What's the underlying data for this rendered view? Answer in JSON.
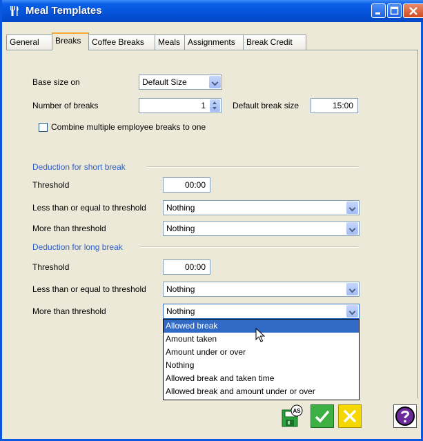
{
  "window": {
    "title": "Meal Templates",
    "title_icon": "fork-knife-icon"
  },
  "tabs": [
    {
      "label": "General",
      "active": false
    },
    {
      "label": "Breaks",
      "active": true
    },
    {
      "label": "Coffee Breaks",
      "active": false
    },
    {
      "label": "Meals",
      "active": false
    },
    {
      "label": "Assignments",
      "active": false
    },
    {
      "label": "Break Credit",
      "active": false
    }
  ],
  "form": {
    "base_size_label": "Base size on",
    "base_size_value": "Default Size",
    "num_breaks_label": "Number of breaks",
    "num_breaks_value": "1",
    "default_break_size_label": "Default break size",
    "default_break_size_value": "15:00",
    "combine_label": "Combine multiple employee breaks to one",
    "combine_checked": false
  },
  "short_break": {
    "heading": "Deduction for short break",
    "threshold_label": "Threshold",
    "threshold_value": "00:00",
    "le_label": "Less than or equal to threshold",
    "le_value": "Nothing",
    "gt_label": "More than threshold",
    "gt_value": "Nothing"
  },
  "long_break": {
    "heading": "Deduction for long break",
    "threshold_label": "Threshold",
    "threshold_value": "00:00",
    "le_label": "Less than or equal to threshold",
    "le_value": "Nothing",
    "gt_label": "More than threshold",
    "gt_value": "Nothing"
  },
  "dropdown_options": [
    "Allowed break",
    "Amount taken",
    "Amount under or over",
    "Nothing",
    "Allowed break and taken time",
    "Allowed break and amount under or over"
  ],
  "dropdown_highlighted": "Allowed break",
  "footer": {
    "save_as_badge": "AS",
    "buttons": [
      "save-as-icon",
      "ok-check-icon",
      "cancel-x-icon",
      "help-icon"
    ]
  },
  "colors": {
    "titlebar": "#0553d8",
    "section_heading": "#2c5fcc",
    "selection": "#316ac5",
    "ok_green": "#3cb043",
    "cancel_yellow": "#f5d800"
  }
}
